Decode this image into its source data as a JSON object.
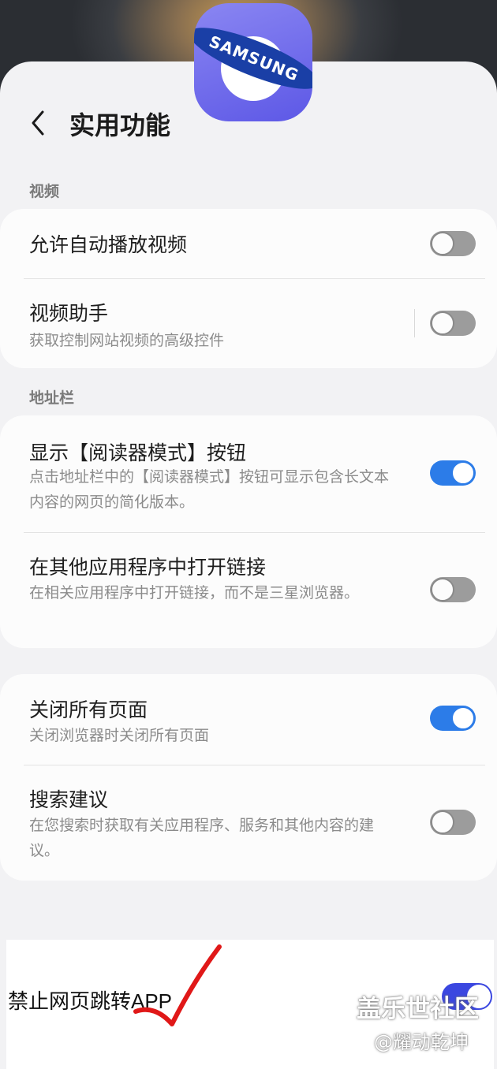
{
  "header": {
    "title": "实用功能",
    "logo_text": "SAMSUNG"
  },
  "sections": {
    "video": {
      "label": "视频",
      "items": [
        {
          "title": "允许自动播放视频",
          "subtitle": "",
          "toggle": "off"
        },
        {
          "title": "视频助手",
          "subtitle": "获取控制网站视频的高级控件",
          "toggle": "off"
        }
      ]
    },
    "address_bar": {
      "label": "地址栏",
      "items": [
        {
          "title": "显示【阅读器模式】按钮",
          "subtitle": "点击地址栏中的【阅读器模式】按钮可显示包含长文本内容的网页的简化版本。",
          "toggle": "on"
        },
        {
          "title": "在其他应用程序中打开链接",
          "subtitle": "在相关应用程序中打开链接，而不是三星浏览器。",
          "toggle": "off"
        }
      ]
    },
    "other": {
      "items": [
        {
          "title": "关闭所有页面",
          "subtitle": "关闭浏览器时关闭所有页面",
          "toggle": "on"
        },
        {
          "title": "搜索建议",
          "subtitle": "在您搜索时获取有关应用程序、服务和其他内容的建议。",
          "toggle": "off"
        }
      ]
    }
  },
  "annotation": {
    "label": "禁止网页跳转APP",
    "toggle": "on"
  },
  "watermark": {
    "line1": "盖乐世社区",
    "line2": "@耀动乾坤"
  },
  "colors": {
    "accent": "#2c7ce8",
    "sheet_bg": "#f2f2f4",
    "card_bg": "#fcfcfc",
    "annotation_check": "#e01818"
  }
}
